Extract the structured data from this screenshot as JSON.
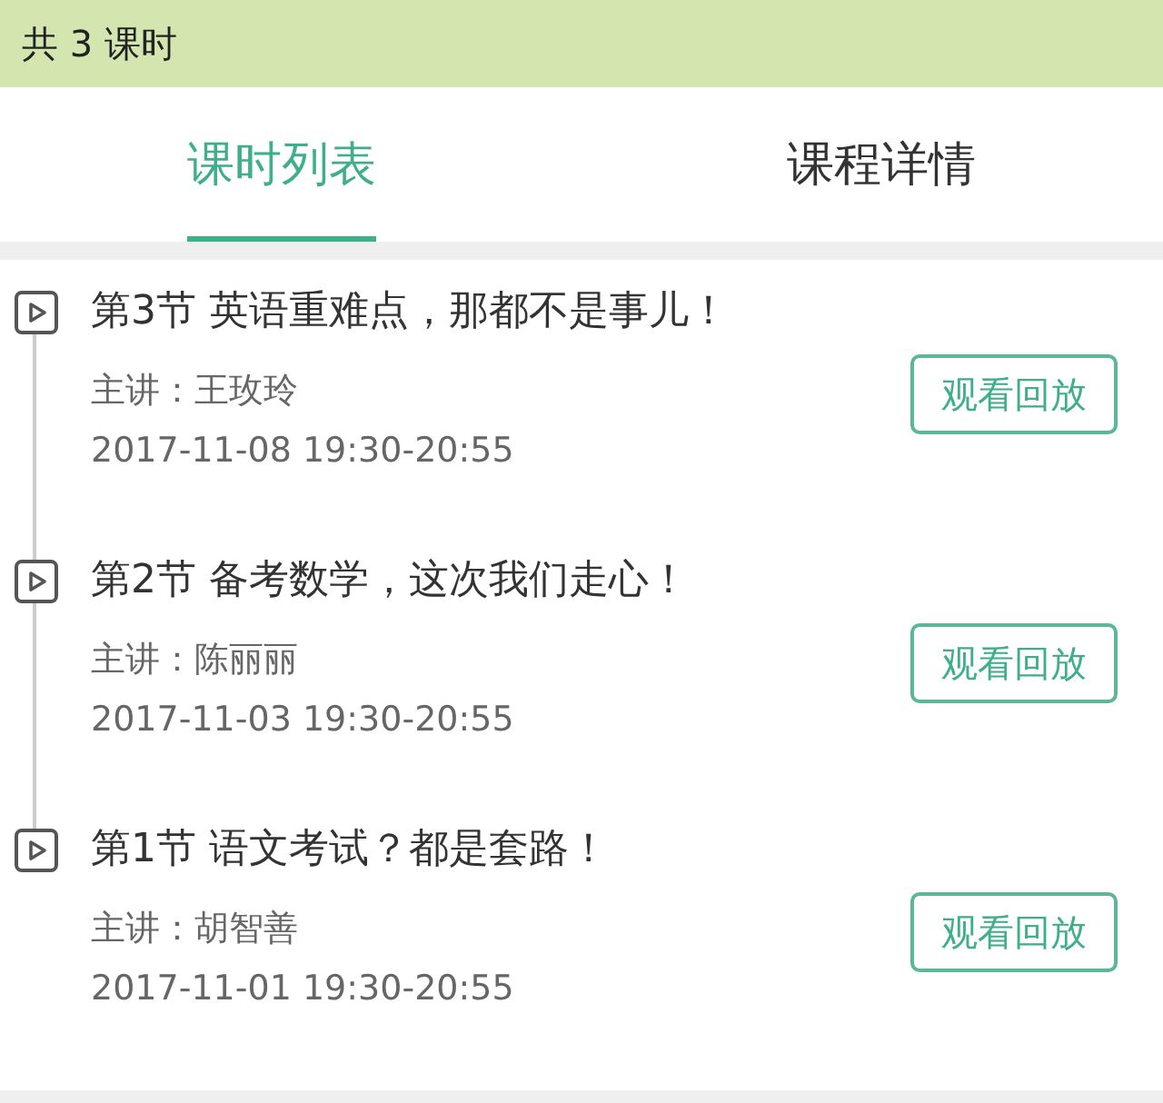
{
  "header": {
    "title": "共 3 课时"
  },
  "tabs": [
    {
      "label": "课时列表",
      "selected": true
    },
    {
      "label": "课程详情",
      "selected": false
    }
  ],
  "lessons": [
    {
      "title": "第3节 英语重难点，那都不是事儿！",
      "teacher": "主讲：王玫玲",
      "time": "2017-11-08 19:30-20:55",
      "button": "观看回放"
    },
    {
      "title": "第2节 备考数学，这次我们走心！",
      "teacher": "主讲：陈丽丽",
      "time": "2017-11-03 19:30-20:55",
      "button": "观看回放"
    },
    {
      "title": "第1节 语文考试？都是套路！",
      "teacher": "主讲：胡智善",
      "time": "2017-11-01 19:30-20:55",
      "button": "观看回放"
    }
  ]
}
